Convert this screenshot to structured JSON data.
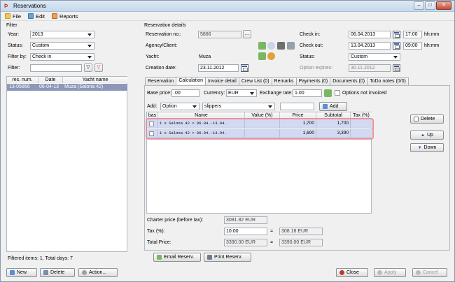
{
  "window": {
    "title": "Reservations",
    "controls": [
      "–",
      "□",
      "✕"
    ]
  },
  "menu": [
    {
      "label": "File",
      "icon": "file-icon"
    },
    {
      "label": "Edit",
      "icon": "edit-icon"
    },
    {
      "label": "Reports",
      "icon": "reports-icon"
    }
  ],
  "filter": {
    "heading": "Filter",
    "year_label": "Year:",
    "year_value": "2013",
    "status_label": "Status:",
    "status_value": "Custom",
    "filter_by_label": "Filter by:",
    "filter_by_value": "Check in",
    "filter_label": "Filter:",
    "filter_value": ""
  },
  "res_table": {
    "headers": [
      "res. num.",
      "Date",
      "Yacht name"
    ],
    "rows": [
      {
        "num": "13-05866",
        "date": "06-04-13",
        "yacht": "Muza (Salona 42)"
      }
    ]
  },
  "footer_left": {
    "filtered": "Filtered items:  1,  Total days: 7"
  },
  "buttons_left": {
    "new": "New",
    "delete": "Delete",
    "action": "Action..."
  },
  "details": {
    "heading": "Reservation details",
    "res_no_label": "Reservation no.:",
    "res_no_value": "5866",
    "agency_label": "Agency/Client:",
    "yacht_label": "Yacht:",
    "yacht_value": "Muza",
    "creation_label": "Creation date:",
    "creation_value": "23.11.2012",
    "checkin_label": "Check in:",
    "checkin_date": "06.04.2013",
    "checkin_time": "17:00",
    "checkin_fmt": "hh:mm",
    "checkout_label": "Check out:",
    "checkout_date": "13.04.2013",
    "checkout_time": "09:00",
    "checkout_fmt": "hh:mm",
    "status_label": "Status:",
    "status_value": "Custom",
    "option_label": "Option expires:",
    "option_value": "30.11.2012"
  },
  "tabs": [
    "Reservation",
    "Calculation",
    "Invoice detail",
    "Crew List (0)",
    "Remarks",
    "Payments (0)",
    "Documents (0)",
    "ToDo notes (0/0)"
  ],
  "calc": {
    "base_label": "Base price:",
    "base_value": ".00",
    "currency_label": "Currency:",
    "currency_value": "EUR",
    "rate_label": "Exchange rate:",
    "rate_value": "1.00",
    "options_label": "Options not invoiced",
    "add_label": "Add:",
    "add_type": "Option",
    "add_item": "slippers",
    "add_btn": "Add",
    "headers": [
      "bas",
      "Name",
      "Value (%)",
      "Price",
      "Subtotal",
      "Tax (%)"
    ],
    "rows": [
      {
        "name": "1 x Salona 42 > 06.04.-13.04.",
        "value": "",
        "price": "1,700",
        "subtotal": "1,700",
        "tax": ""
      },
      {
        "name": "1 x Salona 42 > 06.04.-13.04.",
        "value": "",
        "price": "1,690",
        "subtotal": "3,390",
        "tax": ""
      }
    ],
    "delete_btn": "Delete",
    "up_btn": "Up",
    "down_btn": "Down",
    "charter_label": "Charter price (before tax):",
    "charter_value": "3081.82 EUR",
    "tax_label": "Tax (%):",
    "tax_value": "10.00",
    "tax_eq": "=",
    "tax_amount": "308.18 EUR",
    "total_label": "Total Price:",
    "total_value": "3390.00 EUR",
    "total_eq": "=",
    "total_amount": "3390.00 EUR",
    "email_btn": "Email Reserv.",
    "print_btn": "Print Reserv."
  },
  "buttons_right": {
    "close": "Close",
    "apply": "Apply",
    "cancel": "Cancel"
  }
}
